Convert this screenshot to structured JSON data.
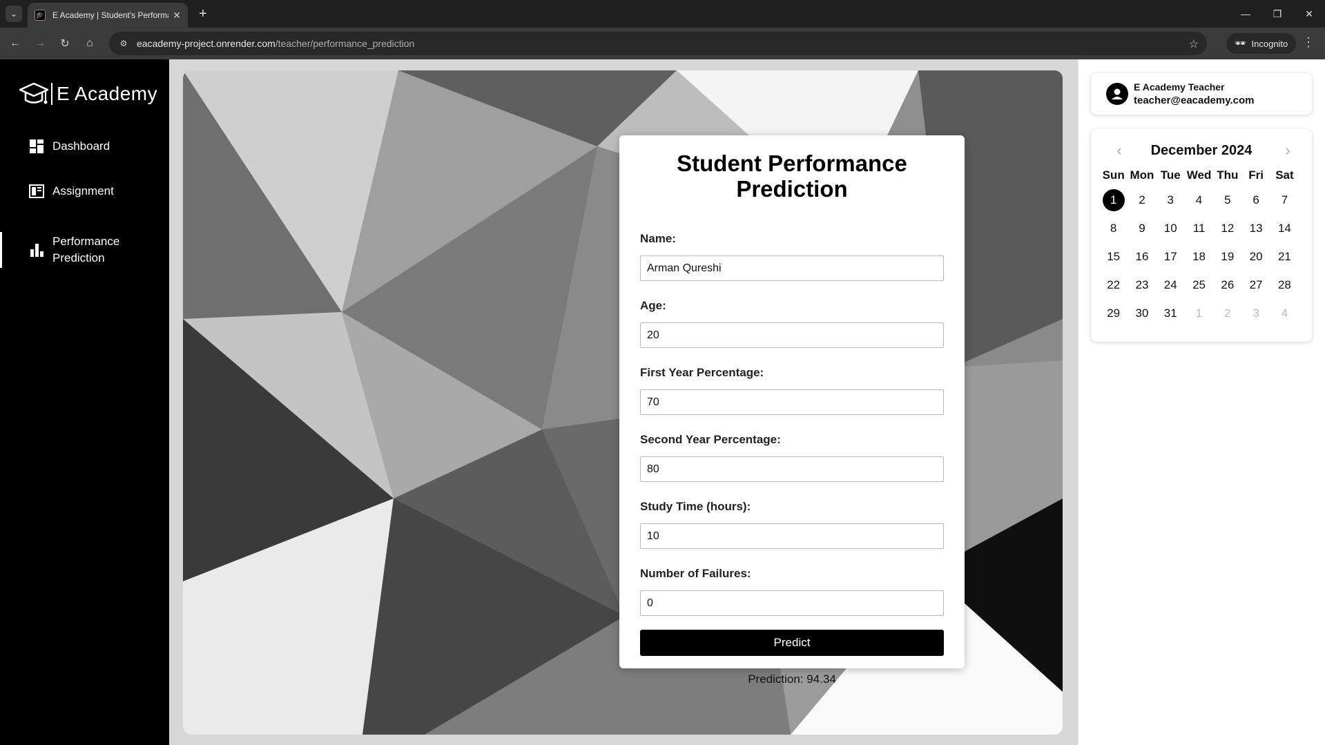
{
  "browser": {
    "tab_title": "E Academy | Student's Performance Prediction",
    "url_host": "eacademy-project.onrender.com",
    "url_path": "/teacher/performance_prediction",
    "incognito_label": "Incognito"
  },
  "sidebar": {
    "logo_text": "E Academy",
    "items": [
      {
        "label": "Dashboard",
        "icon": "dashboard-icon",
        "active": false
      },
      {
        "label": "Assignment",
        "icon": "assignment-icon",
        "active": false
      },
      {
        "label_line1": "Performance",
        "label_line2": "Prediction",
        "icon": "bar-chart-icon",
        "active": true
      }
    ]
  },
  "form": {
    "title": "Student Performance Prediction",
    "fields": [
      {
        "label": "Name:",
        "value": "Arman Qureshi"
      },
      {
        "label": "Age:",
        "value": "20"
      },
      {
        "label": "First Year Percentage:",
        "value": "70"
      },
      {
        "label": "Second Year Percentage:",
        "value": "80"
      },
      {
        "label": "Study Time (hours):",
        "value": "10"
      },
      {
        "label": "Number of Failures:",
        "value": "0"
      }
    ],
    "submit_label": "Predict",
    "result": "Prediction: 94.34"
  },
  "profile": {
    "name": "E Academy Teacher",
    "email": "teacher@eacademy.com"
  },
  "calendar": {
    "title": "December 2024",
    "weekdays": [
      "Sun",
      "Mon",
      "Tue",
      "Wed",
      "Thu",
      "Fri",
      "Sat"
    ],
    "days": [
      {
        "d": "1",
        "today": true
      },
      {
        "d": "2"
      },
      {
        "d": "3"
      },
      {
        "d": "4"
      },
      {
        "d": "5"
      },
      {
        "d": "6"
      },
      {
        "d": "7"
      },
      {
        "d": "8"
      },
      {
        "d": "9"
      },
      {
        "d": "10"
      },
      {
        "d": "11"
      },
      {
        "d": "12"
      },
      {
        "d": "13"
      },
      {
        "d": "14"
      },
      {
        "d": "15"
      },
      {
        "d": "16"
      },
      {
        "d": "17"
      },
      {
        "d": "18"
      },
      {
        "d": "19"
      },
      {
        "d": "20"
      },
      {
        "d": "21"
      },
      {
        "d": "22"
      },
      {
        "d": "23"
      },
      {
        "d": "24"
      },
      {
        "d": "25"
      },
      {
        "d": "26"
      },
      {
        "d": "27"
      },
      {
        "d": "28"
      },
      {
        "d": "29"
      },
      {
        "d": "30"
      },
      {
        "d": "31"
      },
      {
        "d": "1",
        "muted": true
      },
      {
        "d": "2",
        "muted": true
      },
      {
        "d": "3",
        "muted": true
      },
      {
        "d": "4",
        "muted": true
      }
    ]
  }
}
